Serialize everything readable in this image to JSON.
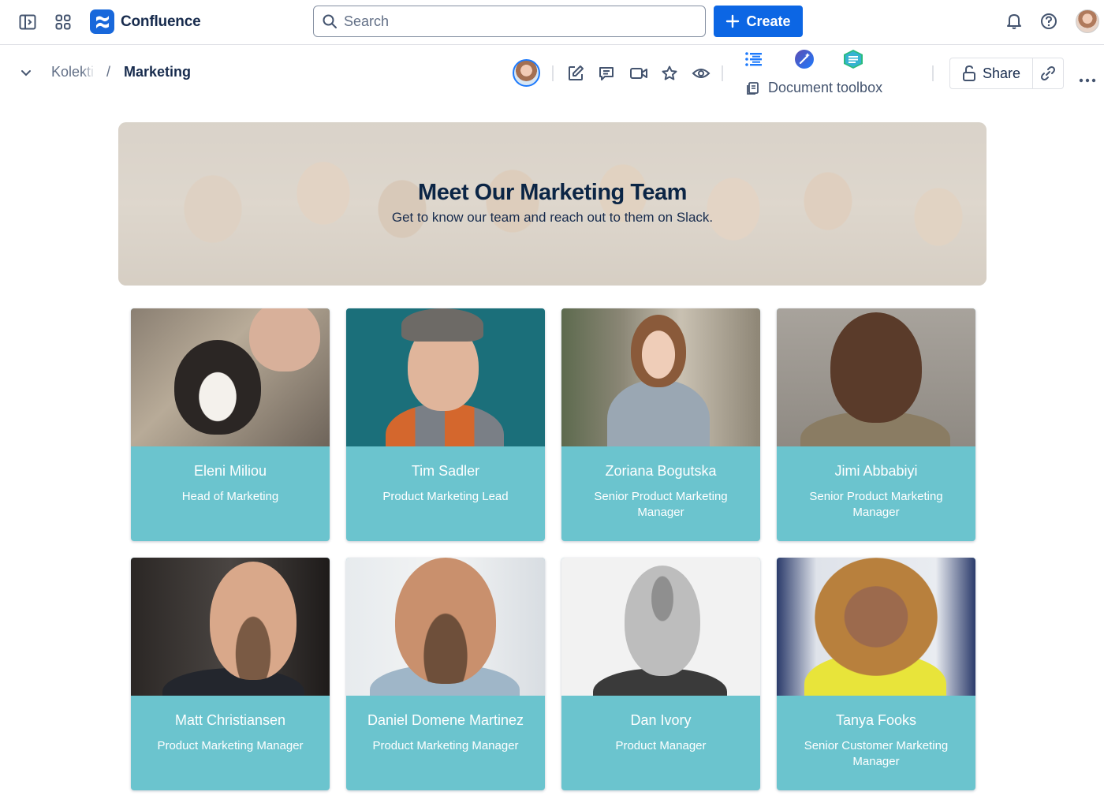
{
  "topbar": {
    "app_name": "Confluence",
    "search_placeholder": "Search",
    "create_label": "Create"
  },
  "pagebar": {
    "breadcrumb_parent": "Kolekti",
    "breadcrumb_separator": "/",
    "breadcrumb_current": "Marketing",
    "toolbox_label": "Document toolbox",
    "share_label": "Share"
  },
  "hero": {
    "title": "Meet Our Marketing Team",
    "subtitle": "Get to know our team and reach out to them on Slack."
  },
  "team": [
    {
      "name": "Eleni Miliou",
      "role": "Head of Marketing"
    },
    {
      "name": "Tim Sadler",
      "role": "Product Marketing Lead"
    },
    {
      "name": "Zoriana Bogutska",
      "role": "Senior Product Marketing Manager"
    },
    {
      "name": "Jimi Abbabiyi",
      "role": "Senior Product Marketing Manager"
    },
    {
      "name": "Matt Christiansen",
      "role": "Product Marketing Manager"
    },
    {
      "name": "Daniel Domene Martinez",
      "role": "Product Marketing Manager"
    },
    {
      "name": "Dan Ivory",
      "role": "Product Manager"
    },
    {
      "name": "Tanya Fooks",
      "role": "Senior Customer Marketing Manager"
    }
  ],
  "colors": {
    "brand": "#0c66e4",
    "card_teal": "#6bc4ce",
    "hero_title": "#0b2545"
  }
}
